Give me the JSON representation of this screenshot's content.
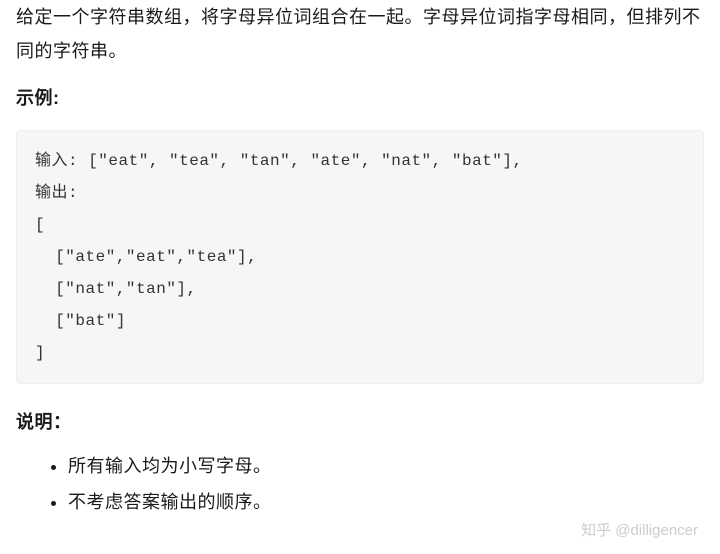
{
  "problem": {
    "description": "给定一个字符串数组，将字母异位词组合在一起。字母异位词指字母相同，但排列不同的字符串。"
  },
  "example": {
    "heading": "示例:",
    "code": "输入: [\"eat\", \"tea\", \"tan\", \"ate\", \"nat\", \"bat\"],\n输出:\n[\n  [\"ate\",\"eat\",\"tea\"],\n  [\"nat\",\"tan\"],\n  [\"bat\"]\n]"
  },
  "notes": {
    "heading": "说明：",
    "items": [
      "所有输入均为小写字母。",
      "不考虑答案输出的顺序。"
    ]
  },
  "watermark": "知乎 @dilligencer"
}
